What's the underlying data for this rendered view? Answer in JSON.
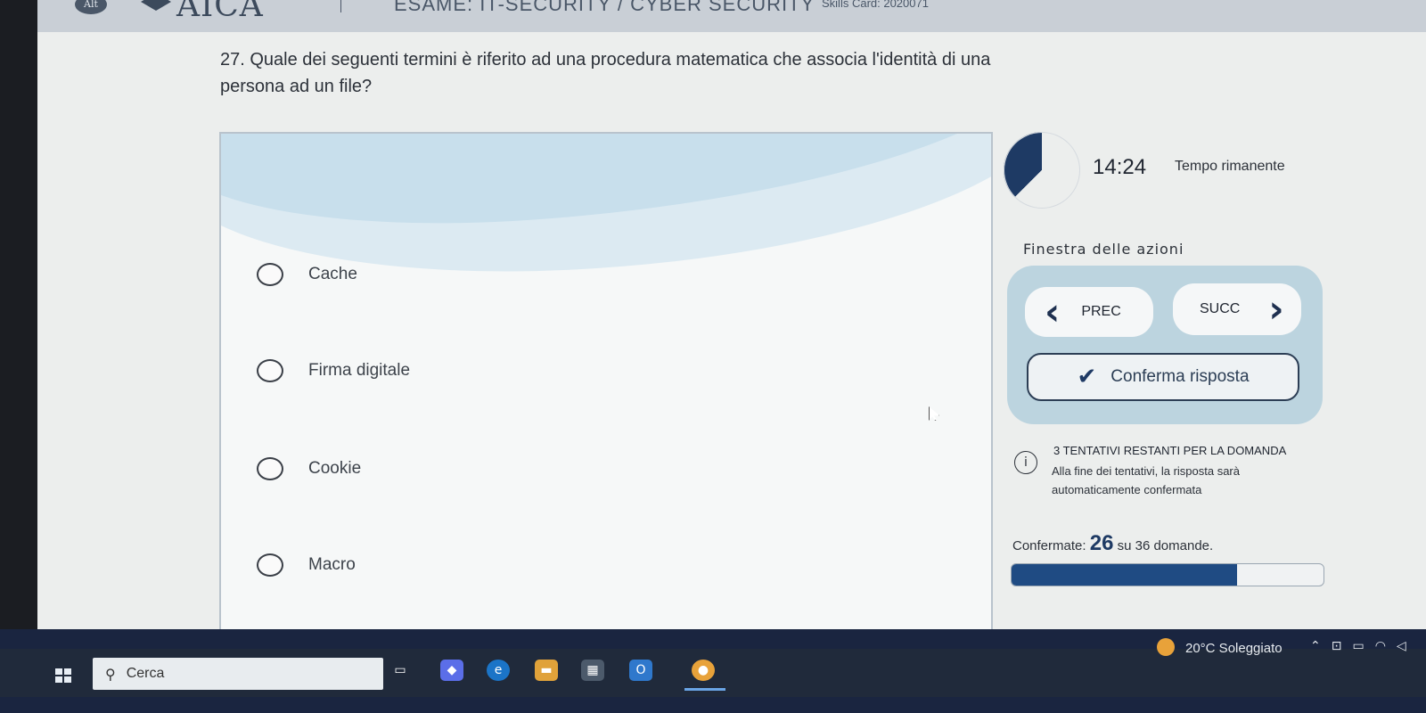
{
  "header": {
    "logo_badge": "Alt",
    "logo_text": "AICA",
    "exam_title": "ESAME: IT-SECURITY / CYBER SECURITY",
    "skills_card": "Skills Card: 2020071"
  },
  "question": {
    "text": "27. Quale dei seguenti termini è riferito ad una procedura matematica che associa l'identità di una persona ad un file?"
  },
  "answers": [
    {
      "label": "Cache"
    },
    {
      "label": "Firma digitale"
    },
    {
      "label": "Cookie"
    },
    {
      "label": "Macro"
    }
  ],
  "timer": {
    "value": "14:24",
    "label": "Tempo rimanente",
    "remaining_fraction": 0.375,
    "color": "#1e3a64"
  },
  "actions": {
    "title": "Finestra delle azioni",
    "prev_label": "PREC",
    "next_label": "SUCC",
    "confirm_label": "Conferma risposta"
  },
  "attempts": {
    "title": "3 TENTATIVI RESTANTI PER LA DOMANDA",
    "description": "Alla fine dei tentativi, la risposta sarà automaticamente confermata"
  },
  "progress": {
    "prefix": "Confermate:",
    "confirmed": "26",
    "suffix": "su 36 domande.",
    "fraction": 0.722,
    "fill_color": "#1f4b83"
  },
  "taskbar": {
    "search_label": "Cerca",
    "weather": "20°C  Soleggiato"
  },
  "colors": {
    "accent": "#1e3a64",
    "panel": "#bcd4df"
  }
}
